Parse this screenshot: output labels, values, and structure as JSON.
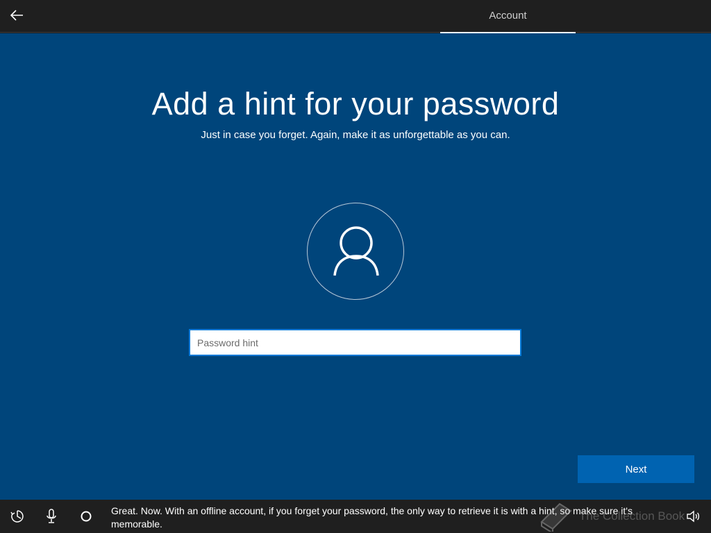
{
  "header": {
    "back_icon": "arrow-left-icon",
    "tab_label": "Account"
  },
  "main": {
    "title": "Add a hint for your password",
    "subtitle": "Just in case you forget. Again, make it as unforgettable as you can.",
    "avatar_icon": "user-icon",
    "hint_input": {
      "value": "",
      "placeholder": "Password hint"
    },
    "next_label": "Next"
  },
  "footer": {
    "icons": [
      "ease-of-access-icon",
      "microphone-icon",
      "cortana-circle-icon",
      "volume-icon"
    ],
    "narration": "Great. Now. With an offline account, if you forget your password, the only way to retrieve it is with a hint, so make sure it's memorable.",
    "watermark": "The Collection Book"
  },
  "colors": {
    "main_background": "#00457b",
    "bar_background": "#1f1f1f",
    "accent": "#0063b1",
    "input_border": "#0078d7"
  }
}
